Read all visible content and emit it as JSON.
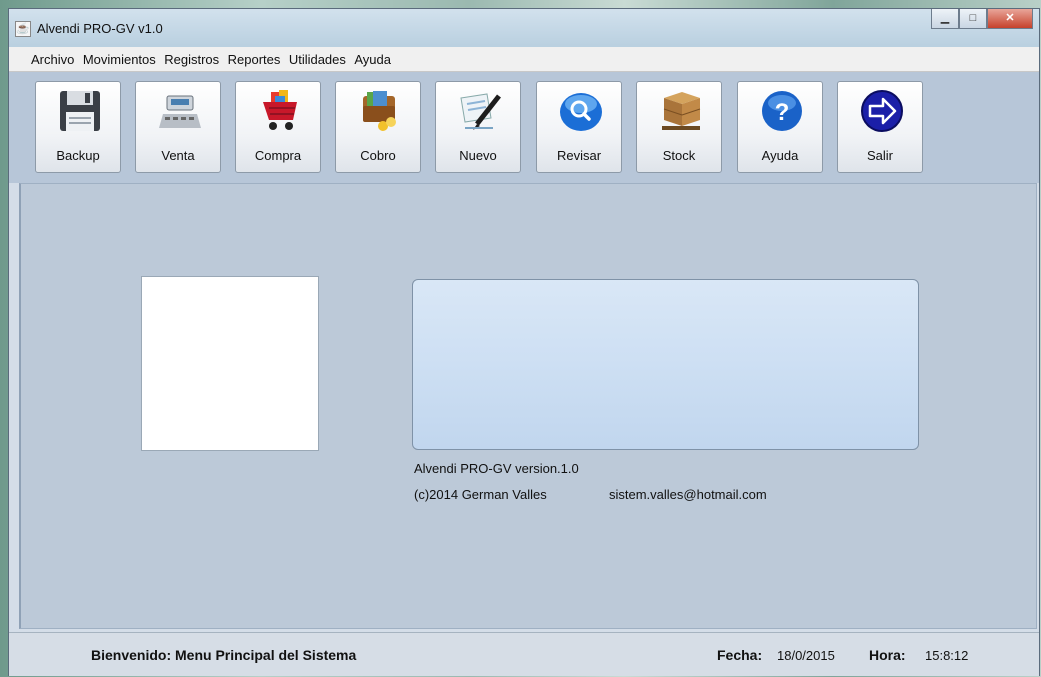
{
  "window": {
    "title": "Alvendi PRO-GV v1.0",
    "min_label": "▁",
    "max_label": "□",
    "close_label": "✕"
  },
  "menu": [
    "Archivo",
    "Movimientos",
    "Registros",
    "Reportes",
    "Utilidades",
    "Ayuda"
  ],
  "toolbar": [
    {
      "label": "Backup",
      "icon": "floppy-disk-icon"
    },
    {
      "label": "Venta",
      "icon": "cash-register-icon"
    },
    {
      "label": "Compra",
      "icon": "shopping-cart-icon"
    },
    {
      "label": "Cobro",
      "icon": "wallet-icon"
    },
    {
      "label": "Nuevo",
      "icon": "pen-document-icon"
    },
    {
      "label": "Revisar",
      "icon": "magnifier-icon"
    },
    {
      "label": "Stock",
      "icon": "boxes-pallet-icon"
    },
    {
      "label": "Ayuda",
      "icon": "help-icon"
    },
    {
      "label": "Salir",
      "icon": "exit-arrow-icon"
    }
  ],
  "main": {
    "version": "Alvendi PRO-GV version.1.0",
    "copyright": "(c)2014 German Valles",
    "email": "sistem.valles@hotmail.com"
  },
  "status": {
    "welcome": "Bienvenido: Menu Principal del Sistema",
    "fecha_label": "Fecha:",
    "fecha_value": "18/0/2015",
    "hora_label": "Hora:",
    "hora_value": "15:8:12"
  },
  "colors": {
    "toolbar_bg": "#b7c6d8",
    "content_bg": "#bcc9d8",
    "panel_bg": "#cddff3",
    "status_bg": "#d6dde6"
  }
}
